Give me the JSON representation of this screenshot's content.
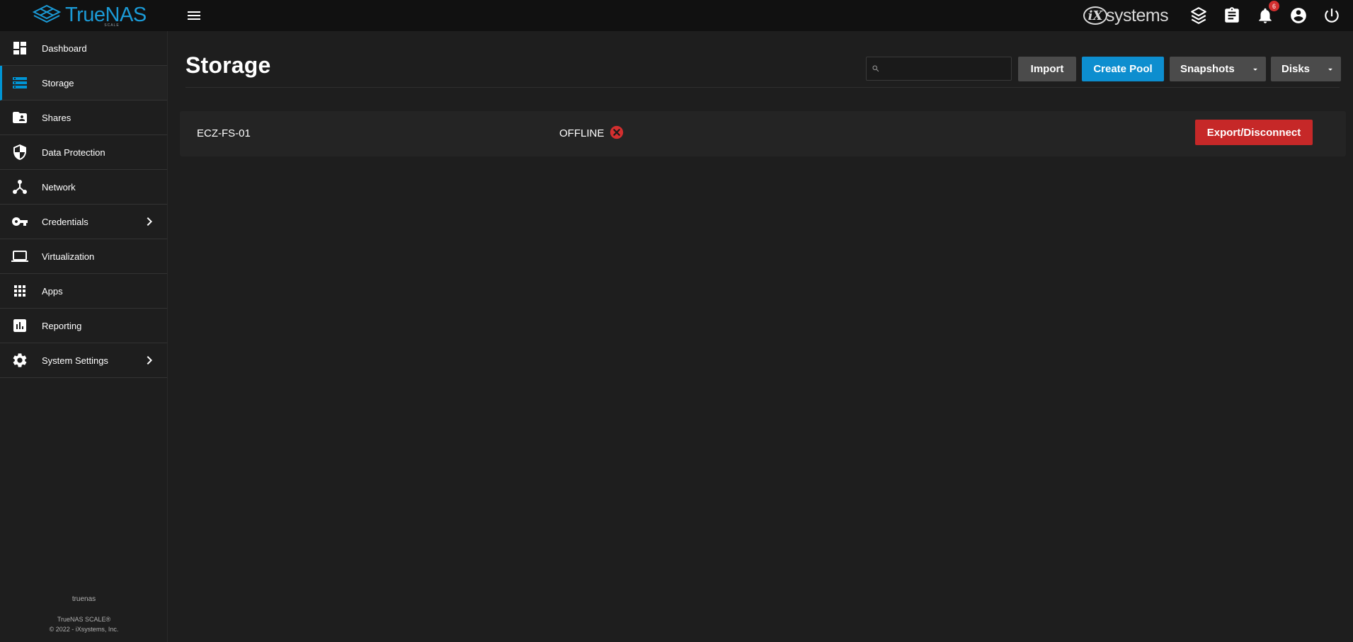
{
  "app": {
    "logo_text": "TrueNAS",
    "logo_sub": "SCALE",
    "vendor_logo_text": "systems",
    "vendor_logo_mark": "iX",
    "notification_count": "6",
    "accent_color": "#0095d5"
  },
  "topbar": {
    "icons": [
      "menu-icon",
      "truecommand-icon",
      "task-manager-icon",
      "notifications-icon",
      "account-icon",
      "power-icon"
    ]
  },
  "sidebar": {
    "items": [
      {
        "label": "Dashboard",
        "icon": "dashboard-icon",
        "active": false,
        "has_submenu": false
      },
      {
        "label": "Storage",
        "icon": "storage-icon",
        "active": true,
        "has_submenu": false
      },
      {
        "label": "Shares",
        "icon": "folder-shared-icon",
        "active": false,
        "has_submenu": false
      },
      {
        "label": "Data Protection",
        "icon": "shield-icon",
        "active": false,
        "has_submenu": false
      },
      {
        "label": "Network",
        "icon": "network-icon",
        "active": false,
        "has_submenu": false
      },
      {
        "label": "Credentials",
        "icon": "key-icon",
        "active": false,
        "has_submenu": true
      },
      {
        "label": "Virtualization",
        "icon": "laptop-icon",
        "active": false,
        "has_submenu": false
      },
      {
        "label": "Apps",
        "icon": "apps-grid-icon",
        "active": false,
        "has_submenu": false
      },
      {
        "label": "Reporting",
        "icon": "chart-icon",
        "active": false,
        "has_submenu": false
      },
      {
        "label": "System Settings",
        "icon": "gear-icon",
        "active": false,
        "has_submenu": true
      }
    ],
    "hostname": "truenas",
    "version": "TrueNAS SCALE®",
    "copyright": "© 2022 - iXsystems, Inc."
  },
  "main": {
    "title": "Storage",
    "search": {
      "value": "",
      "placeholder": ""
    },
    "buttons": {
      "import": "Import",
      "create_pool": "Create Pool",
      "snapshots": "Snapshots",
      "disks": "Disks"
    },
    "pools": [
      {
        "name": "ECZ-FS-01",
        "status": "OFFLINE",
        "status_color": "#d32f2f",
        "action": "Export/Disconnect"
      }
    ]
  }
}
